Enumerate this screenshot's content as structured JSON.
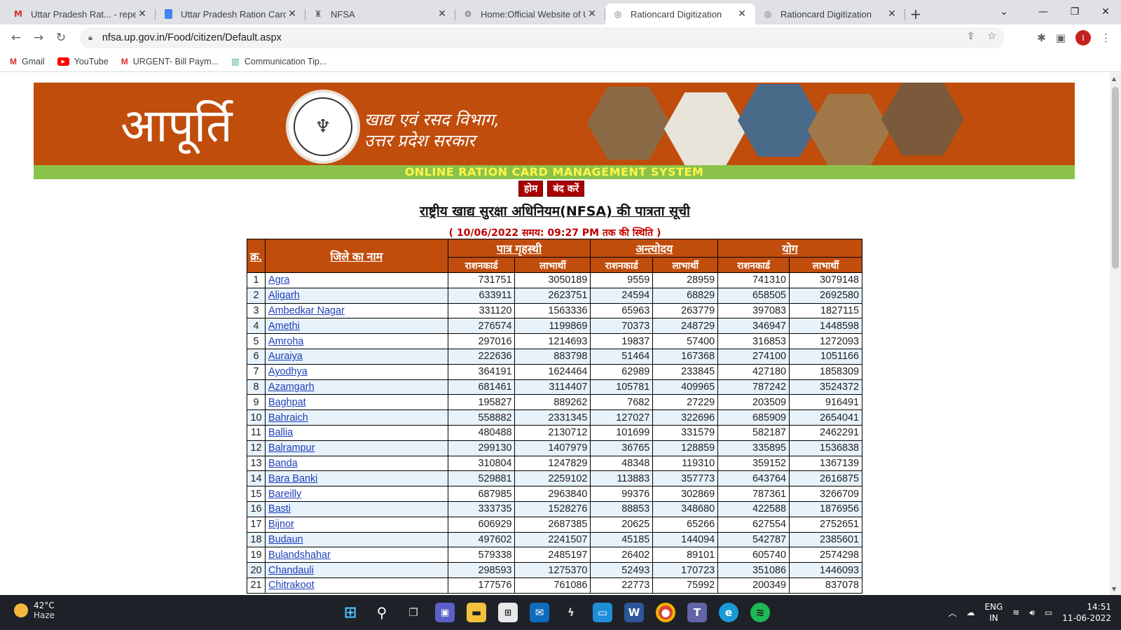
{
  "browser": {
    "tabs": [
      {
        "title": "Uttar Pradesh Rat... - repetiti",
        "icon": "gmail-icon"
      },
      {
        "title": "Uttar Pradesh Ration Card L",
        "icon": "docs-icon"
      },
      {
        "title": "NFSA",
        "icon": "emblem-icon"
      },
      {
        "title": "Home:Official Website of Ut",
        "icon": "site-icon"
      },
      {
        "title": "Rationcard Digitization",
        "icon": "globe-icon"
      },
      {
        "title": "Rationcard Digitization",
        "icon": "globe-icon"
      }
    ],
    "url": "nfsa.up.gov.in/Food/citizen/Default.aspx",
    "avatar_letter": "I",
    "bookmarks": [
      {
        "label": "Gmail",
        "icon": "gmail-icon"
      },
      {
        "label": "YouTube",
        "icon": "youtube-icon"
      },
      {
        "label": "URGENT- Bill Paym...",
        "icon": "gmail-icon"
      },
      {
        "label": "Communication Tip...",
        "icon": "chart-icon"
      }
    ]
  },
  "banner": {
    "title": "आपूर्ति",
    "dept_line1": "खाद्य एवं रसद विभाग,",
    "dept_line2": "उत्तर प्रदेश सरकार",
    "system_name": "ONLINE RATION CARD MANAGEMENT SYSTEM"
  },
  "nav": {
    "home": "होम",
    "close": "बंद करें"
  },
  "page": {
    "title": "राष्ट्रीय खाद्य सुरक्षा अधिनियम(NFSA) की पात्रता सूची",
    "status": "( 10/06/2022 समय: 09:27 PM तक की स्थिति )"
  },
  "table": {
    "col_serial": "क्र.",
    "col_district": "जिले का नाम",
    "group_phh": "पात्र गृहस्थी",
    "group_aay": "अन्त्योदय",
    "group_total": "योग",
    "sub_cards": "राशनकार्ड",
    "sub_beneficiaries": "लाभार्थी",
    "rows": [
      [
        "1",
        "Agra",
        "731751",
        "3050189",
        "9559",
        "28959",
        "741310",
        "3079148"
      ],
      [
        "2",
        "Aligarh",
        "633911",
        "2623751",
        "24594",
        "68829",
        "658505",
        "2692580"
      ],
      [
        "3",
        "Ambedkar Nagar",
        "331120",
        "1563336",
        "65963",
        "263779",
        "397083",
        "1827115"
      ],
      [
        "4",
        "Amethi",
        "276574",
        "1199869",
        "70373",
        "248729",
        "346947",
        "1448598"
      ],
      [
        "5",
        "Amroha",
        "297016",
        "1214693",
        "19837",
        "57400",
        "316853",
        "1272093"
      ],
      [
        "6",
        "Auraiya",
        "222636",
        "883798",
        "51464",
        "167368",
        "274100",
        "1051166"
      ],
      [
        "7",
        "Ayodhya",
        "364191",
        "1624464",
        "62989",
        "233845",
        "427180",
        "1858309"
      ],
      [
        "8",
        "Azamgarh",
        "681461",
        "3114407",
        "105781",
        "409965",
        "787242",
        "3524372"
      ],
      [
        "9",
        "Baghpat",
        "195827",
        "889262",
        "7682",
        "27229",
        "203509",
        "916491"
      ],
      [
        "10",
        "Bahraich",
        "558882",
        "2331345",
        "127027",
        "322696",
        "685909",
        "2654041"
      ],
      [
        "11",
        "Ballia",
        "480488",
        "2130712",
        "101699",
        "331579",
        "582187",
        "2462291"
      ],
      [
        "12",
        "Balrampur",
        "299130",
        "1407979",
        "36765",
        "128859",
        "335895",
        "1536838"
      ],
      [
        "13",
        "Banda",
        "310804",
        "1247829",
        "48348",
        "119310",
        "359152",
        "1367139"
      ],
      [
        "14",
        "Bara Banki",
        "529881",
        "2259102",
        "113883",
        "357773",
        "643764",
        "2616875"
      ],
      [
        "15",
        "Bareilly",
        "687985",
        "2963840",
        "99376",
        "302869",
        "787361",
        "3266709"
      ],
      [
        "16",
        "Basti",
        "333735",
        "1528276",
        "88853",
        "348680",
        "422588",
        "1876956"
      ],
      [
        "17",
        "Bijnor",
        "606929",
        "2687385",
        "20625",
        "65266",
        "627554",
        "2752651"
      ],
      [
        "18",
        "Budaun",
        "497602",
        "2241507",
        "45185",
        "144094",
        "542787",
        "2385601"
      ],
      [
        "19",
        "Bulandshahar",
        "579338",
        "2485197",
        "26402",
        "89101",
        "605740",
        "2574298"
      ],
      [
        "20",
        "Chandauli",
        "298593",
        "1275370",
        "52493",
        "170723",
        "351086",
        "1446093"
      ],
      [
        "21",
        "Chitrakoot",
        "177576",
        "761086",
        "22773",
        "75992",
        "200349",
        "837078"
      ]
    ]
  },
  "taskbar": {
    "temperature": "42°C",
    "condition": "Haze",
    "lang1": "ENG",
    "lang2": "IN",
    "time": "14:51",
    "date": "11-06-2022"
  },
  "colors": {
    "banner": "#c04d0c",
    "greenbar": "#8bc34a",
    "button": "#a80000",
    "link": "#1f3fb8",
    "row_alt": "#e8f2fb"
  }
}
